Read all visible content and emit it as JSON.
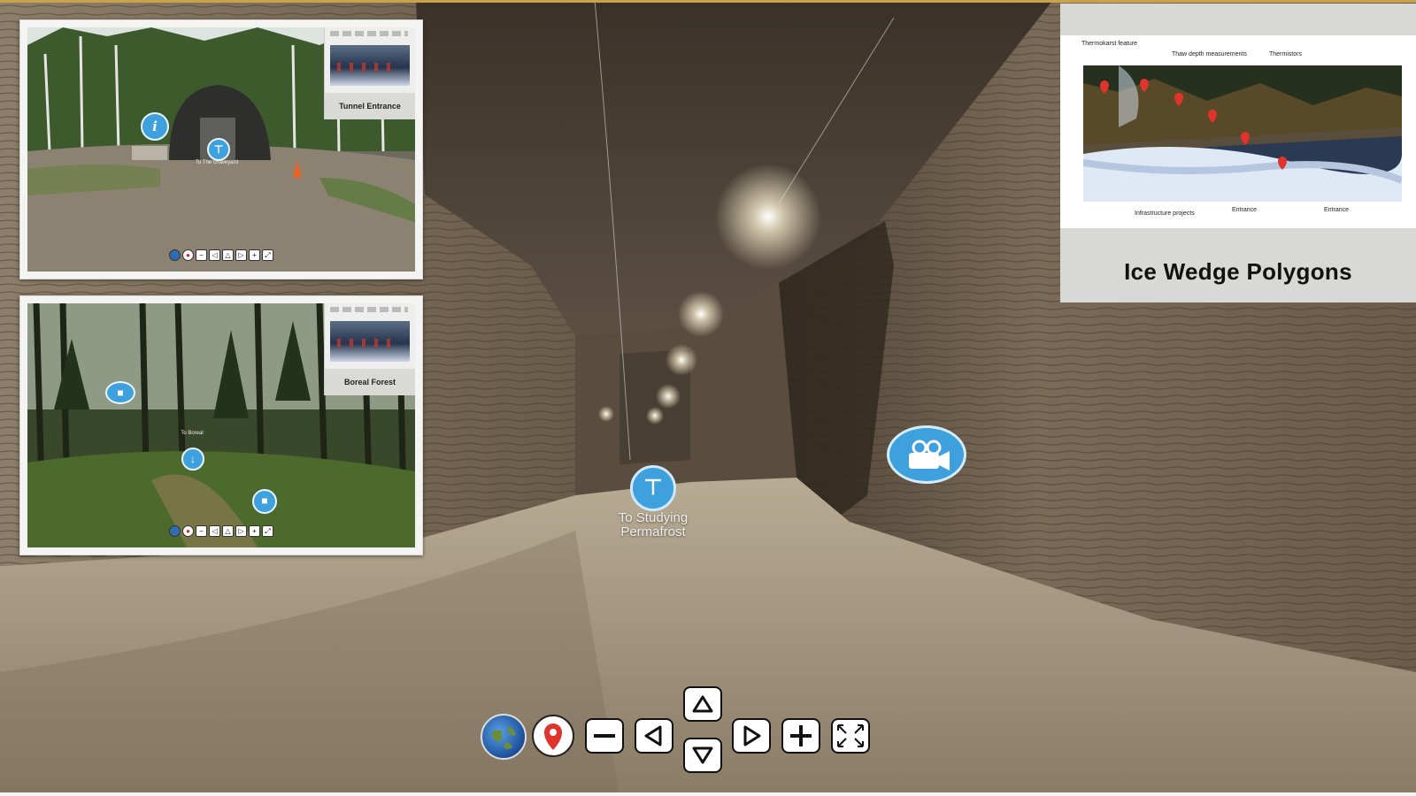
{
  "previews": [
    {
      "id": "tunnel-entrance",
      "thumb_caption": "Tunnel Entrance",
      "hotspot_label": "To The Graveyard"
    },
    {
      "id": "boreal-forest",
      "thumb_caption": "Boreal Forest",
      "hotspot_label": "To Boreal"
    }
  ],
  "info_panel": {
    "title": "Ice Wedge Polygons",
    "labels": {
      "thermokarst": "Thermokarst feature",
      "thaw_depth": "Thaw depth measurements",
      "thermistors": "Thermistors",
      "infrastructure": "Infrastructure projects",
      "entrance_1": "Entrance",
      "entrance_2": "Entrance"
    }
  },
  "hotspots": {
    "nav_label": "To Studying Permafrost"
  },
  "toolbar": {
    "buttons": [
      {
        "name": "globe-button",
        "icon": "globe-icon"
      },
      {
        "name": "map-pin-button",
        "icon": "map-pin-icon"
      },
      {
        "name": "zoom-out-button",
        "icon": "minus-icon"
      },
      {
        "name": "pan-left-button",
        "icon": "triangle-left-icon"
      },
      {
        "name": "pan-up-button",
        "icon": "triangle-up-icon"
      },
      {
        "name": "pan-down-button",
        "icon": "triangle-down-icon"
      },
      {
        "name": "pan-right-button",
        "icon": "triangle-right-icon"
      },
      {
        "name": "zoom-in-button",
        "icon": "plus-icon"
      },
      {
        "name": "fullscreen-button",
        "icon": "fullscreen-icon"
      }
    ]
  },
  "colors": {
    "hotspot": "#3ea0dc",
    "pin": "#e0332c",
    "accent_line": "#c9a24a"
  }
}
